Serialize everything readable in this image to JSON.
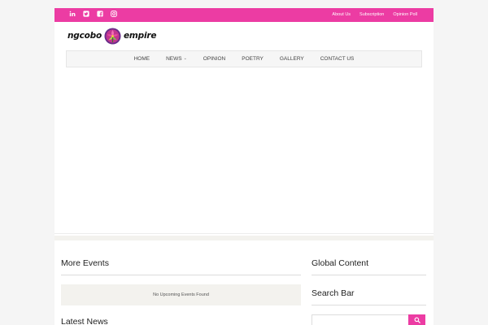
{
  "topbar": {
    "social_icons": [
      "linkedin-icon",
      "twitter-icon",
      "facebook-icon",
      "instagram-icon"
    ],
    "links": [
      "About Us",
      "Subscription",
      "Opinion Poll"
    ],
    "color": "#ec3ca3"
  },
  "logo": {
    "left_word": "ngcobo",
    "right_word": "empire"
  },
  "nav": {
    "items": [
      {
        "label": "HOME",
        "has_dropdown": false
      },
      {
        "label": "NEWS",
        "has_dropdown": true
      },
      {
        "label": "OPINION",
        "has_dropdown": false
      },
      {
        "label": "POETRY",
        "has_dropdown": false
      },
      {
        "label": "GALLERY",
        "has_dropdown": false
      },
      {
        "label": "CONTACT US",
        "has_dropdown": false
      }
    ]
  },
  "main": {
    "more_events_title": "More Events",
    "no_events_text": "No Upcoming Events Found",
    "latest_news_title": "Latest News"
  },
  "sidebar": {
    "global_content_title": "Global Content",
    "search_bar_title": "Search Bar",
    "search_value": ""
  },
  "colors": {
    "accent": "#ec3ca3",
    "panel": "#f3f2ee"
  }
}
